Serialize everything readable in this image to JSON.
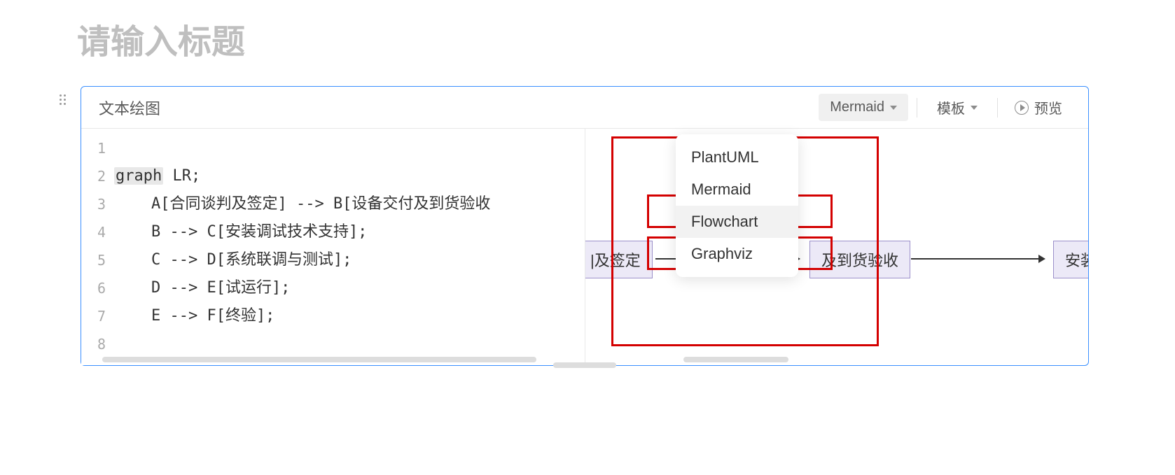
{
  "page_title": "请输入标题",
  "block": {
    "title": "文本绘图",
    "engine_label": "Mermaid",
    "template_label": "模板",
    "preview_label": "预览"
  },
  "dropdown": {
    "items": [
      "PlantUML",
      "Mermaid",
      "Flowchart",
      "Graphviz"
    ],
    "selected": "Mermaid",
    "hover": "Flowchart"
  },
  "code": {
    "line_numbers": [
      "1",
      "2",
      "3",
      "4",
      "5",
      "6",
      "7",
      "8"
    ],
    "keyword": "graph",
    "lines_raw": [
      "",
      "graph LR;",
      "    A[合同谈判及签定] --> B[设备交付及到货验收",
      "    B --> C[安装调试技术支持];",
      "    C --> D[系统联调与测试];",
      "    D --> E[试运行];",
      "    E --> F[终验];",
      ""
    ],
    "l2_rest": " LR;",
    "l3": "    A[合同谈判及签定] --> B[设备交付及到货验收",
    "l4": "    B --> C[安装调试技术支持];",
    "l5": "    C --> D[系统联调与测试];",
    "l6": "    D --> E[试运行];",
    "l7": "    E --> F[终验];"
  },
  "preview_nodes": {
    "n1": "|及签定",
    "n2": "及到货验收",
    "n3": "安装"
  }
}
